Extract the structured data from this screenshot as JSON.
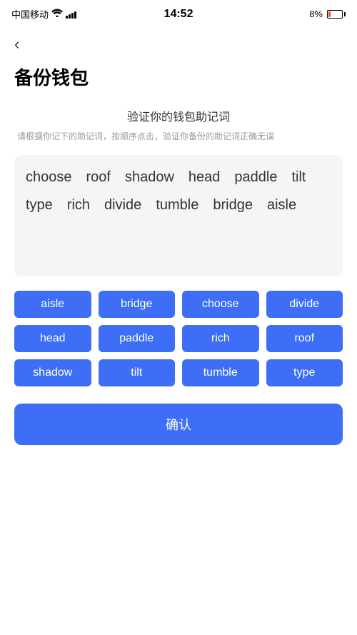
{
  "statusBar": {
    "carrier": "中国移动",
    "time": "14:52",
    "batteryPercent": "8%"
  },
  "page": {
    "backLabel": "‹",
    "title": "备份钱包",
    "sectionTitle": "验证你的钱包助记词",
    "sectionDesc": "请根据你记下的助记词，按顺序点击，验证你备份的助记词正确无误",
    "displayWords": [
      "choose",
      "roof",
      "shadow",
      "head",
      "paddle",
      "tilt",
      "type",
      "rich",
      "divide",
      "tumble",
      "bridge",
      "aisle"
    ],
    "wordButtons": [
      "aisle",
      "bridge",
      "choose",
      "divide",
      "head",
      "paddle",
      "rich",
      "roof",
      "shadow",
      "tilt",
      "tumble",
      "type"
    ],
    "confirmLabel": "确认"
  }
}
